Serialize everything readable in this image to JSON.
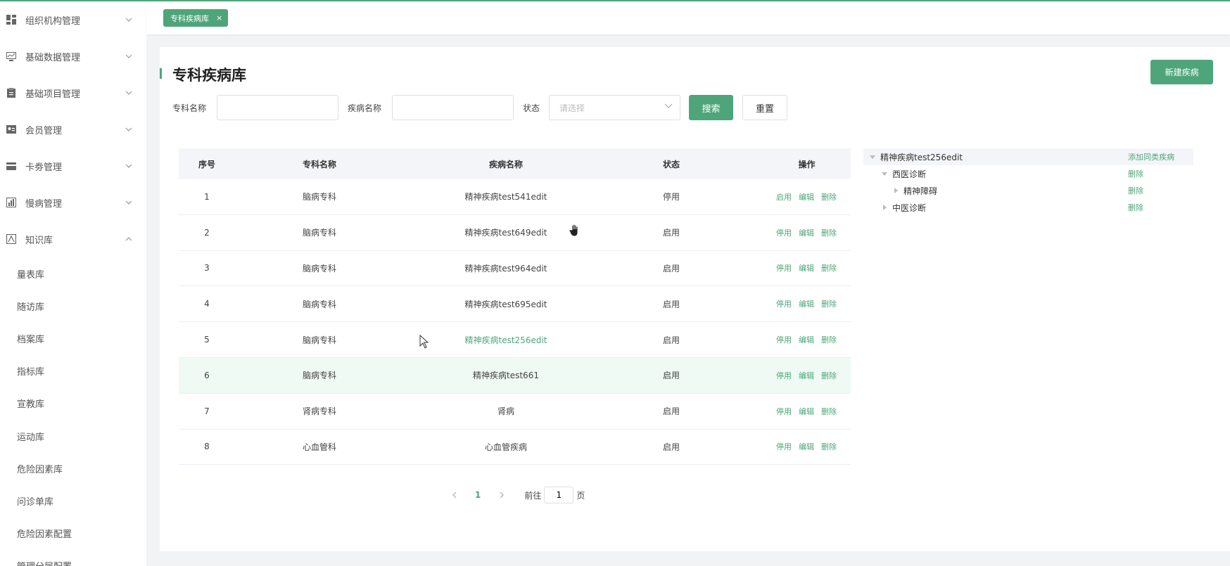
{
  "sidebar": {
    "menus": [
      {
        "label": "组织机构管理",
        "icon": "dashboard-icon",
        "expanded": false
      },
      {
        "label": "基础数据管理",
        "icon": "monitor-icon",
        "expanded": false
      },
      {
        "label": "基础项目管理",
        "icon": "clipboard-icon",
        "expanded": false
      },
      {
        "label": "会员管理",
        "icon": "id-card-icon",
        "expanded": false
      },
      {
        "label": "卡劵管理",
        "icon": "card-icon",
        "expanded": false
      },
      {
        "label": "慢病管理",
        "icon": "chart-icon",
        "expanded": false
      },
      {
        "label": "知识库",
        "icon": "book-icon",
        "expanded": true
      }
    ],
    "subitems": [
      "量表库",
      "随访库",
      "档案库",
      "指标库",
      "宣教库",
      "运动库",
      "危险因素库",
      "问诊单库",
      "危险因素配置",
      "管理分层配置"
    ]
  },
  "tabbar": {
    "active_tab": "专科疾病库",
    "close_glyph": "×"
  },
  "page": {
    "title": "专科疾病库",
    "new_button": "新建疾病"
  },
  "filters": {
    "specialty_label": "专科名称",
    "disease_label": "疾病名称",
    "status_label": "状态",
    "status_placeholder": "请选择",
    "search_button": "搜索",
    "reset_button": "重置"
  },
  "table": {
    "headers": [
      "序号",
      "专科名称",
      "疾病名称",
      "状态",
      "操作"
    ],
    "rows": [
      {
        "no": "1",
        "specialty": "脑病专科",
        "disease": "精神疾病test541edit",
        "status": "停用",
        "toggle": "启用"
      },
      {
        "no": "2",
        "specialty": "脑病专科",
        "disease": "精神疾病test649edit",
        "status": "启用",
        "toggle": "停用"
      },
      {
        "no": "3",
        "specialty": "脑病专科",
        "disease": "精神疾病test964edit",
        "status": "启用",
        "toggle": "停用"
      },
      {
        "no": "4",
        "specialty": "脑病专科",
        "disease": "精神疾病test695edit",
        "status": "启用",
        "toggle": "停用"
      },
      {
        "no": "5",
        "specialty": "脑病专科",
        "disease": "精神疾病test256edit",
        "status": "启用",
        "toggle": "停用"
      },
      {
        "no": "6",
        "specialty": "脑病专科",
        "disease": "精神疾病test661",
        "status": "启用",
        "toggle": "停用"
      },
      {
        "no": "7",
        "specialty": "肾病专科",
        "disease": "肾病",
        "status": "启用",
        "toggle": "停用"
      },
      {
        "no": "8",
        "specialty": "心血管科",
        "disease": "心血管疾病",
        "status": "启用",
        "toggle": "停用"
      }
    ],
    "edit_label": "编辑",
    "delete_label": "删除"
  },
  "pagination": {
    "current": "1",
    "goto_prefix": "前往",
    "goto_value": "1",
    "goto_suffix": "页"
  },
  "tree": {
    "root": {
      "label": "精神疾病test256edit",
      "action": "添加同类疾病"
    },
    "children": [
      {
        "label": "西医诊断",
        "action": "删除",
        "level": 1,
        "expanded": true
      },
      {
        "label": "精神障碍",
        "action": "删除",
        "level": 2,
        "expanded": false
      },
      {
        "label": "中医诊断",
        "action": "删除",
        "level": 1,
        "expanded": false
      }
    ]
  },
  "colors": {
    "accent": "#4fa57a",
    "highlight_row": "#eefaf3",
    "header_bg": "#f4f5f8"
  }
}
